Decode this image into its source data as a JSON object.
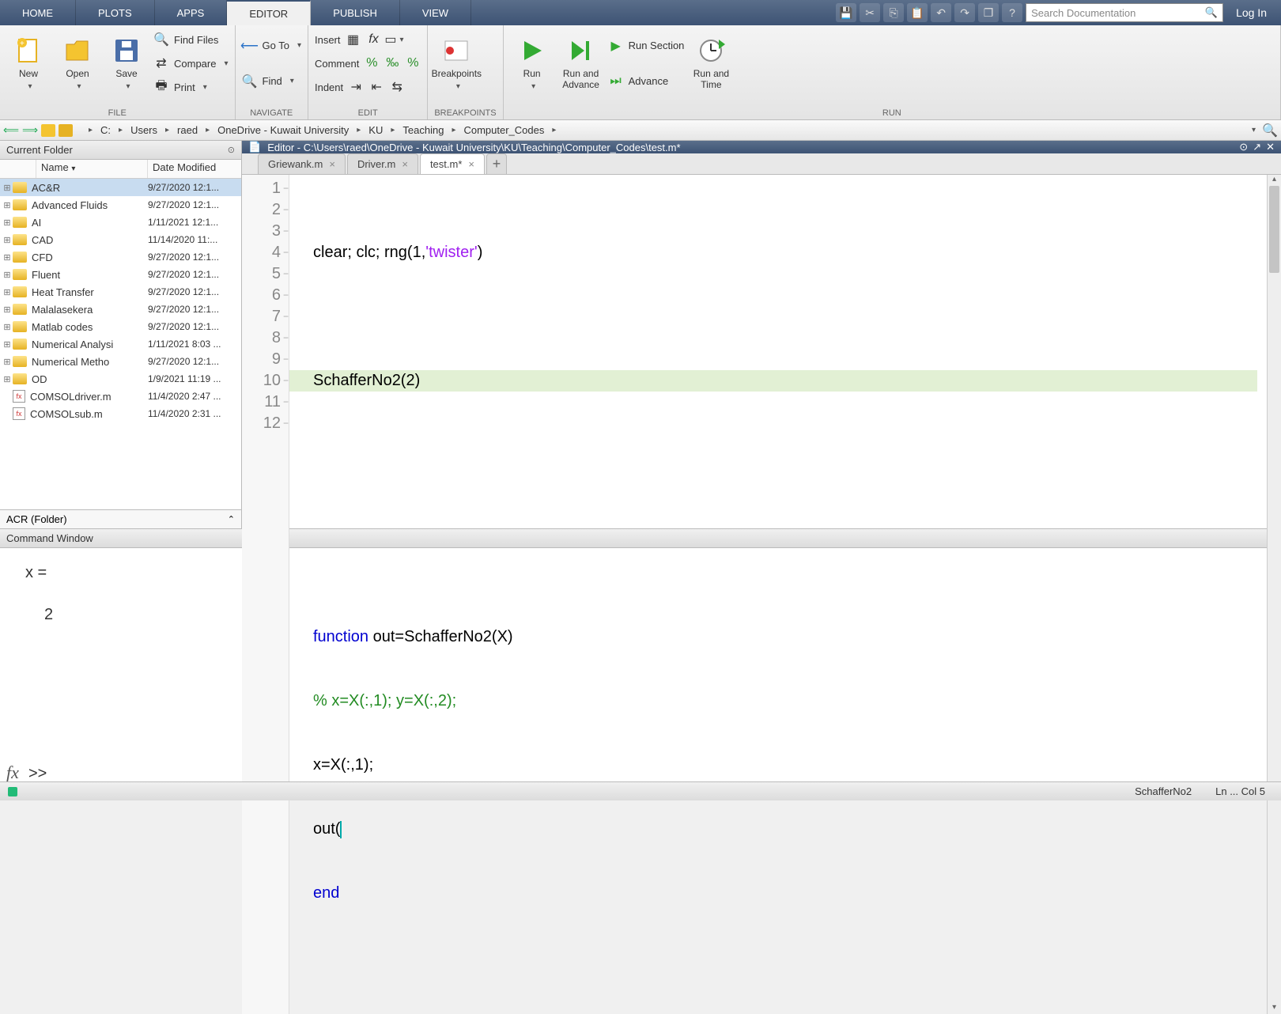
{
  "menu": {
    "tabs": [
      "HOME",
      "PLOTS",
      "APPS",
      "EDITOR",
      "PUBLISH",
      "VIEW"
    ],
    "active": 3,
    "search_placeholder": "Search Documentation",
    "login": "Log In"
  },
  "ribbon": {
    "file": {
      "label": "FILE",
      "new": "New",
      "open": "Open",
      "save": "Save",
      "find_files": "Find Files",
      "compare": "Compare",
      "print": "Print"
    },
    "navigate": {
      "label": "NAVIGATE",
      "goto": "Go To",
      "find": "Find"
    },
    "edit": {
      "label": "EDIT",
      "insert": "Insert",
      "comment": "Comment",
      "indent": "Indent"
    },
    "breakpoints": {
      "label": "BREAKPOINTS",
      "btn": "Breakpoints"
    },
    "run": {
      "label": "RUN",
      "run": "Run",
      "run_advance": "Run and\nAdvance",
      "run_section": "Run Section",
      "advance": "Advance",
      "run_time": "Run and\nTime"
    }
  },
  "address": {
    "crumbs": [
      "C:",
      "Users",
      "raed",
      "OneDrive - Kuwait University",
      "KU",
      "Teaching",
      "Computer_Codes"
    ]
  },
  "current_folder": {
    "title": "Current Folder",
    "col_name": "Name",
    "col_date": "Date Modified",
    "detail": "ACR  (Folder)",
    "files": [
      {
        "type": "folder",
        "name": "AC&R",
        "date": "9/27/2020 12:1...",
        "selected": true
      },
      {
        "type": "folder",
        "name": "Advanced Fluids",
        "date": "9/27/2020 12:1..."
      },
      {
        "type": "folder",
        "name": "AI",
        "date": "1/11/2021 12:1..."
      },
      {
        "type": "folder",
        "name": "CAD",
        "date": "11/14/2020 11:..."
      },
      {
        "type": "folder",
        "name": "CFD",
        "date": "9/27/2020 12:1..."
      },
      {
        "type": "folder",
        "name": "Fluent",
        "date": "9/27/2020 12:1..."
      },
      {
        "type": "folder",
        "name": "Heat Transfer",
        "date": "9/27/2020 12:1..."
      },
      {
        "type": "folder",
        "name": "Malalasekera",
        "date": "9/27/2020 12:1..."
      },
      {
        "type": "folder",
        "name": "Matlab codes",
        "date": "9/27/2020 12:1..."
      },
      {
        "type": "folder",
        "name": "Numerical Analysi",
        "date": "1/11/2021 8:03 ..."
      },
      {
        "type": "folder",
        "name": "Numerical Metho",
        "date": "9/27/2020 12:1..."
      },
      {
        "type": "folder",
        "name": "OD",
        "date": "1/9/2021 11:19 ..."
      },
      {
        "type": "file",
        "name": "COMSOLdriver.m",
        "date": "11/4/2020 2:47 ..."
      },
      {
        "type": "file",
        "name": "COMSOLsub.m",
        "date": "11/4/2020 2:31 ..."
      }
    ]
  },
  "editor": {
    "title": "Editor - C:\\Users\\raed\\OneDrive - Kuwait University\\KU\\Teaching\\Computer_Codes\\test.m*",
    "tabs": [
      {
        "label": "Griewank.m",
        "active": false
      },
      {
        "label": "Driver.m",
        "active": false
      },
      {
        "label": "test.m*",
        "active": true
      }
    ],
    "line_count": 12,
    "highlight_line": 10,
    "code": {
      "l1_a": "clear; clc; rng(1,",
      "l1_b": "'twister'",
      "l1_c": ")",
      "l3": "SchafferNo2(2)",
      "l7_kw": "function",
      "l7_rest": " out=SchafferNo2(X)",
      "l8": "% x=X(:,1); y=X(:,2);",
      "l9": "x=X(:,1);",
      "l10": "out(",
      "l11": "end"
    }
  },
  "command": {
    "title": "Command Window",
    "out1": "x =",
    "out2": "     2",
    "prompt": ">>"
  },
  "status": {
    "func": "SchafferNo2",
    "pos": "Ln  ...  Col  5"
  }
}
